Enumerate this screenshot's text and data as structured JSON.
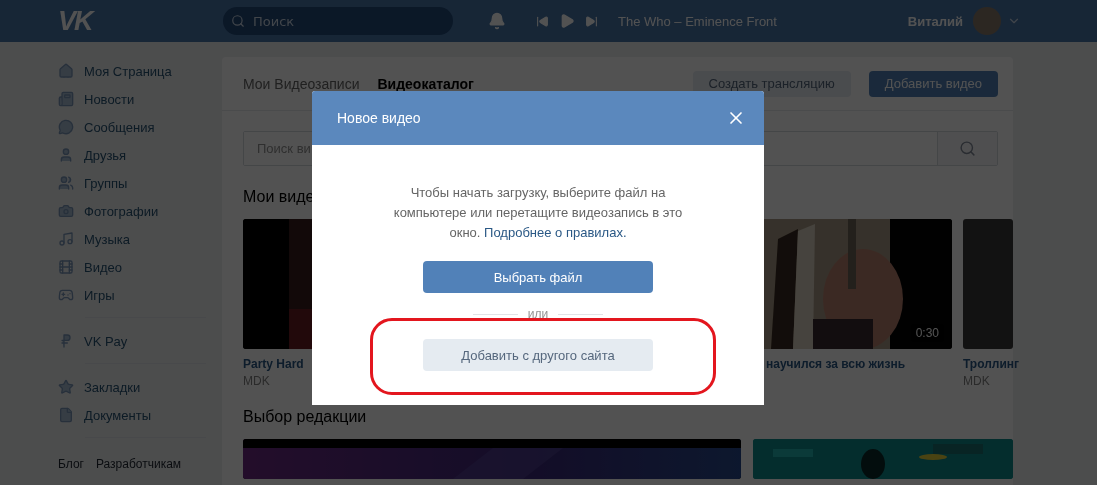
{
  "header": {
    "logo": "VK",
    "search": {
      "placeholder": "Поиск"
    },
    "player": {
      "track": "The Who – Eminence Front",
      "playing": false
    },
    "user": {
      "name": "Виталий"
    }
  },
  "sidebar": {
    "groups": [
      {
        "items": [
          "Моя Страница",
          "Новости",
          "Сообщения",
          "Друзья",
          "Группы",
          "Фотографии",
          "Музыка",
          "Видео",
          "Игры"
        ]
      },
      {
        "items": [
          "VK Pay"
        ]
      },
      {
        "items": [
          "Закладки",
          "Документы"
        ]
      }
    ],
    "footer_links": [
      "Блог",
      "Разработчикам"
    ]
  },
  "content": {
    "tabs": [
      {
        "label": "Мои Видеозаписи",
        "selected": false
      },
      {
        "label": "Видеокаталог",
        "selected": true
      }
    ],
    "buttons": [
      {
        "label": "Создать трансляцию",
        "kind": "secondary"
      },
      {
        "label": "Добавить видео",
        "kind": "primary"
      }
    ],
    "search": {
      "placeholder": "Поиск ви"
    },
    "my_videos": {
      "title": "Мои виде",
      "videos": [
        {
          "title": "Party Hard",
          "author": "MDK"
        },
        {
          "title": "научился за всю жизнь",
          "duration": "0:30"
        },
        {
          "title": "Троллинг",
          "author": "MDK"
        }
      ]
    },
    "editors_choice": {
      "title": "Выбор редакции"
    }
  },
  "modal": {
    "title": "Новое видео",
    "text": "Чтобы начать загрузку, выберите файл на компьютере или перетащите видеозапись в это окно.",
    "link": "Подробнее о правилах.",
    "primary_button": "Выбрать файл",
    "separator": "или",
    "secondary_button": "Добавить с другого сайта",
    "highlighted": true
  }
}
